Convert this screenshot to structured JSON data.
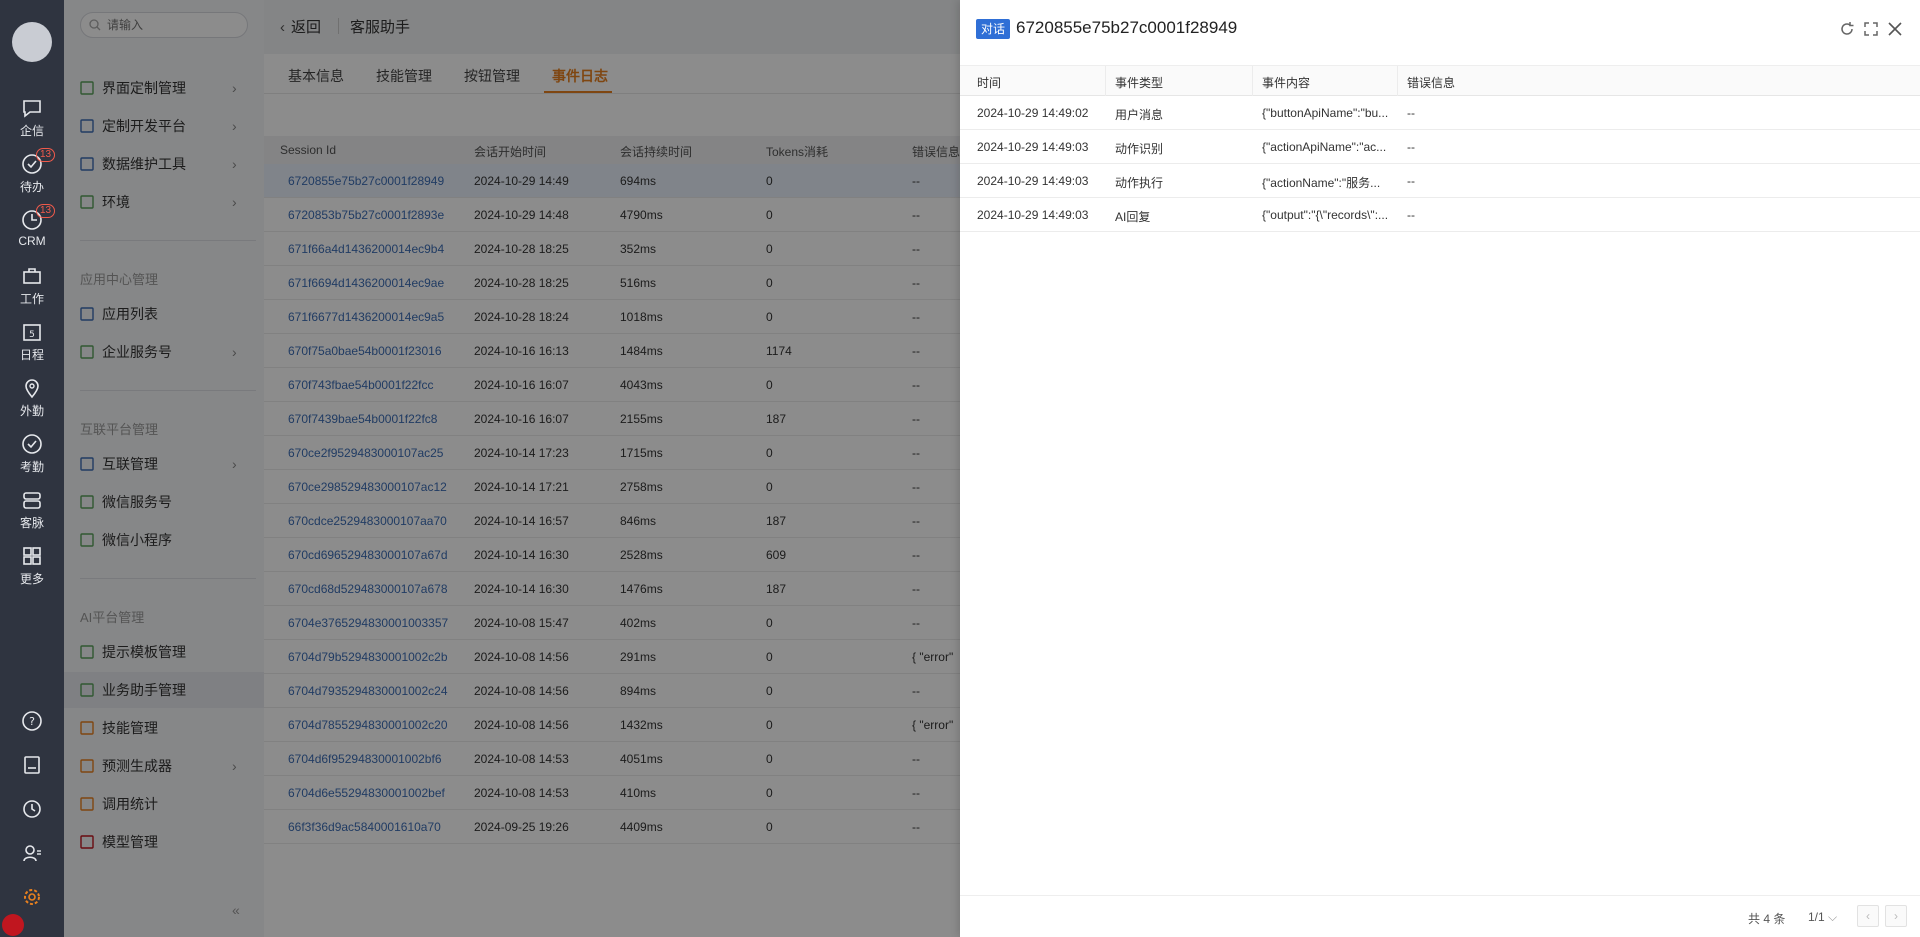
{
  "rail": {
    "items": [
      {
        "label": "企信",
        "icon": "chat-bubble-icon"
      },
      {
        "label": "待办",
        "icon": "check-circle-icon",
        "badge": "13"
      },
      {
        "label": "CRM",
        "icon": "pie-clock-icon",
        "badge": "13"
      },
      {
        "label": "工作",
        "icon": "briefcase-icon"
      },
      {
        "label": "日程",
        "icon": "calendar-icon",
        "day": "5"
      },
      {
        "label": "外勤",
        "icon": "location-pin-icon"
      },
      {
        "label": "考勤",
        "icon": "check-badge-icon"
      },
      {
        "label": "客脉",
        "icon": "contacts-icon"
      },
      {
        "label": "更多",
        "icon": "grid-icon"
      }
    ]
  },
  "sidebar": {
    "search_placeholder": "请输入",
    "items": [
      {
        "label": "界面定制管理",
        "chevron": true
      },
      {
        "label": "定制开发平台",
        "chevron": true
      },
      {
        "label": "数据维护工具",
        "chevron": true
      },
      {
        "label": "环境",
        "chevron": true
      }
    ],
    "group_app": "应用中心管理",
    "app_items": [
      {
        "label": "应用列表",
        "chevron": false
      },
      {
        "label": "企业服务号",
        "chevron": true
      }
    ],
    "group_link": "互联平台管理",
    "link_items": [
      {
        "label": "互联管理",
        "chevron": true
      },
      {
        "label": "微信服务号",
        "chevron": false
      },
      {
        "label": "微信小程序",
        "chevron": false
      }
    ],
    "group_ai": "AI平台管理",
    "ai_items": [
      {
        "label": "提示模板管理",
        "chevron": false
      },
      {
        "label": "业务助手管理",
        "chevron": false,
        "active": true
      },
      {
        "label": "技能管理",
        "chevron": false
      },
      {
        "label": "预测生成器",
        "chevron": true
      },
      {
        "label": "调用统计",
        "chevron": false
      },
      {
        "label": "模型管理",
        "chevron": false
      }
    ]
  },
  "header": {
    "back": "返回",
    "title": "客服助手"
  },
  "tabs": [
    "基本信息",
    "技能管理",
    "按钮管理",
    "事件日志"
  ],
  "table": {
    "columns": [
      "Session Id",
      "会话开始时间",
      "会话持续时间",
      "Tokens消耗",
      "错误信息"
    ],
    "rows": [
      [
        "6720855e75b27c0001f28949",
        "2024-10-29 14:49",
        "694ms",
        "0",
        "--"
      ],
      [
        "6720853b75b27c0001f2893e",
        "2024-10-29 14:48",
        "4790ms",
        "0",
        "--"
      ],
      [
        "671f66a4d1436200014ec9b4",
        "2024-10-28 18:25",
        "352ms",
        "0",
        "--"
      ],
      [
        "671f6694d1436200014ec9ae",
        "2024-10-28 18:25",
        "516ms",
        "0",
        "--"
      ],
      [
        "671f6677d1436200014ec9a5",
        "2024-10-28 18:24",
        "1018ms",
        "0",
        "--"
      ],
      [
        "670f75a0bae54b0001f23016",
        "2024-10-16 16:13",
        "1484ms",
        "1174",
        "--"
      ],
      [
        "670f743fbae54b0001f22fcc",
        "2024-10-16 16:07",
        "4043ms",
        "0",
        "--"
      ],
      [
        "670f7439bae54b0001f22fc8",
        "2024-10-16 16:07",
        "2155ms",
        "187",
        "--"
      ],
      [
        "670ce2f9529483000107ac25",
        "2024-10-14 17:23",
        "1715ms",
        "0",
        "--"
      ],
      [
        "670ce298529483000107ac12",
        "2024-10-14 17:21",
        "2758ms",
        "0",
        "--"
      ],
      [
        "670cdce2529483000107aa70",
        "2024-10-14 16:57",
        "846ms",
        "187",
        "--"
      ],
      [
        "670cd696529483000107a67d",
        "2024-10-14 16:30",
        "2528ms",
        "609",
        "--"
      ],
      [
        "670cd68d529483000107a678",
        "2024-10-14 16:30",
        "1476ms",
        "187",
        "--"
      ],
      [
        "6704e3765294830001003357",
        "2024-10-08 15:47",
        "402ms",
        "0",
        "--"
      ],
      [
        "6704d79b5294830001002c2b",
        "2024-10-08 14:56",
        "291ms",
        "0",
        "{   \"error\""
      ],
      [
        "6704d7935294830001002c24",
        "2024-10-08 14:56",
        "894ms",
        "0",
        "--"
      ],
      [
        "6704d7855294830001002c20",
        "2024-10-08 14:56",
        "1432ms",
        "0",
        "{   \"error\""
      ],
      [
        "6704d6f95294830001002bf6",
        "2024-10-08 14:53",
        "4051ms",
        "0",
        "--"
      ],
      [
        "6704d6e55294830001002bef",
        "2024-10-08 14:53",
        "410ms",
        "0",
        "--"
      ],
      [
        "66f3f36d9ac5840001610a70",
        "2024-09-25 19:26",
        "4409ms",
        "0",
        "--"
      ]
    ]
  },
  "drawer": {
    "tag": "对话",
    "title": "6720855e75b27c0001f28949",
    "columns": [
      "时间",
      "事件类型",
      "事件内容",
      "错误信息"
    ],
    "rows": [
      [
        "2024-10-29 14:49:02",
        "用户消息",
        "{\"buttonApiName\":\"bu...",
        "--"
      ],
      [
        "2024-10-29 14:49:03",
        "动作识别",
        "{\"actionApiName\":\"ac...",
        "--"
      ],
      [
        "2024-10-29 14:49:03",
        "动作执行",
        "{\"actionName\":\"服务...",
        "--"
      ],
      [
        "2024-10-29 14:49:03",
        "AI回复",
        "{\"output\":\"{\\\"records\\\":...",
        "--"
      ]
    ],
    "total": "共 4 条",
    "page": "1/1"
  }
}
